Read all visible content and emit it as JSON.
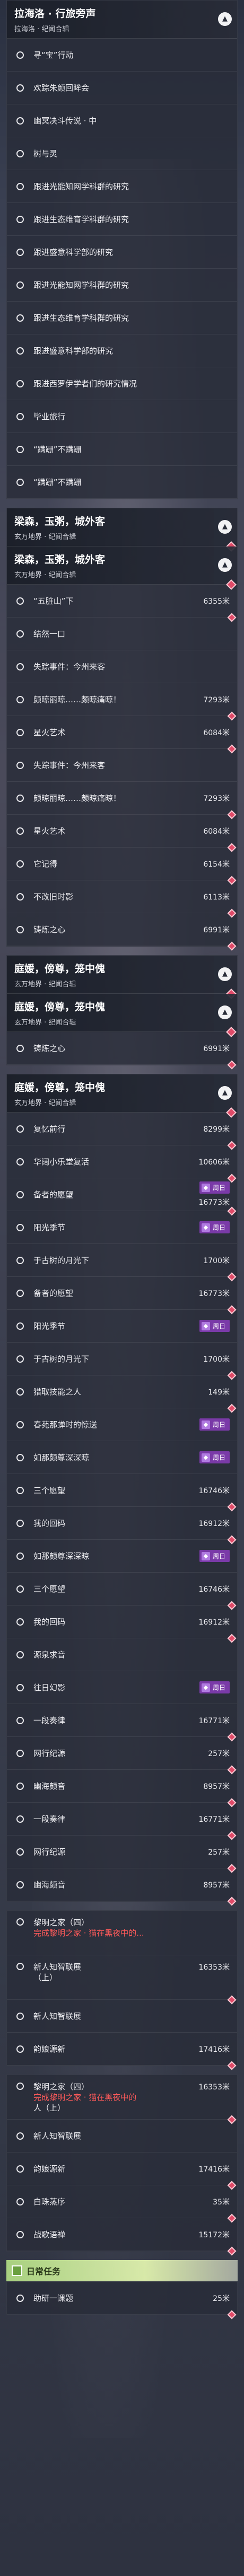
{
  "panels": [
    {
      "title": "拉海洛 · 行旅旁声",
      "subtitle": "拉海洛 · 纪闻合辑",
      "tasks": [
        {
          "name": "寻“宝”行动",
          "dist": ""
        },
        {
          "name": "欢踪朱颜回眸会",
          "dist": ""
        },
        {
          "name": "幽冥决斗传说 · 中",
          "dist": ""
        },
        {
          "name": "树与灵",
          "dist": ""
        },
        {
          "name": "跟进光能知网学科群的研究",
          "dist": ""
        },
        {
          "name": "跟进生态维育学科群的研究",
          "dist": ""
        },
        {
          "name": "跟进盛意科学部的研究",
          "dist": ""
        },
        {
          "name": "跟进光能知网学科群的研究",
          "dist": ""
        },
        {
          "name": "跟进生态维育学科群的研究",
          "dist": ""
        },
        {
          "name": "跟进盛意科学部的研究",
          "dist": ""
        },
        {
          "name": "跟进西罗伊学者们的研究情况",
          "dist": ""
        },
        {
          "name": "毕业旅行",
          "dist": ""
        },
        {
          "name": "“蹒跚”不蹒跚",
          "dist": ""
        },
        {
          "name": "“蹒跚”不蹒跚",
          "dist": ""
        }
      ]
    },
    {
      "title": "梁森，玉粥，城外客",
      "subtitle": "玄万地界 · 纪闻合辑",
      "tasks": [
        {
          "name": "梁森，玉粥，城外客",
          "dist": "",
          "isSubHeader": true
        },
        {
          "name": "“五脏山”下",
          "dist": "6355米"
        },
        {
          "name": "结然一口",
          "dist": ""
        },
        {
          "name": "失踪事件：今州来客",
          "dist": ""
        },
        {
          "name": "颇晾丽晾……颇晾痛晾！",
          "dist": "7293米"
        },
        {
          "name": "星火艺术",
          "dist": "6084米"
        },
        {
          "name": "失踪事件：今州来客",
          "dist": ""
        },
        {
          "name": "颇晾丽晾……颇晾痛晾！",
          "dist": "7293米"
        },
        {
          "name": "星火艺术",
          "dist": "6084米"
        },
        {
          "name": "它记得",
          "dist": "6154米"
        },
        {
          "name": "不改旧时影",
          "dist": "6113米"
        },
        {
          "name": "铸炼之心",
          "dist": "6991米"
        }
      ]
    },
    {
      "title": "庭媛，傍尊，笼中傀",
      "subtitle": "玄万地界 · 纪闻合辑",
      "tasks": [
        {
          "name": "庭媛，傍尊，笼中傀",
          "dist": "",
          "isSubHeader": true
        },
        {
          "name": "铸炼之心",
          "dist": "6991米"
        }
      ]
    },
    {
      "title": "庭媛，傍尊，笼中傀",
      "subtitle": "玄万地界 · 纪闻合辑",
      "tasks": [
        {
          "name": "复忆前行",
          "dist": "8299米"
        },
        {
          "name": "华阔小乐堂复活",
          "dist": "10606米"
        },
        {
          "name": "备者的愿望",
          "dist": "16773米",
          "badge": "周日"
        },
        {
          "name": "阳光季节",
          "dist": "",
          "badge": "周日"
        },
        {
          "name": "于古树的月光下",
          "dist": "1700米"
        },
        {
          "name": "备者的愿望",
          "dist": "16773米"
        },
        {
          "name": "阳光季节",
          "dist": "",
          "badge": "周日"
        },
        {
          "name": "于古树的月光下",
          "dist": "1700米"
        },
        {
          "name": "猎取技能之人",
          "dist": "149米"
        },
        {
          "name": "春苑那蝉时的惊送",
          "dist": "",
          "badge": "周日"
        },
        {
          "name": "如那颇尊深深晾",
          "dist": "",
          "badge": "周日"
        },
        {
          "name": "三个愿望",
          "dist": "16746米"
        },
        {
          "name": "我的回码",
          "dist": "16912米"
        },
        {
          "name": "如那颇尊深深晾",
          "dist": "",
          "badge": "周日"
        },
        {
          "name": "三个愿望",
          "dist": "16746米"
        },
        {
          "name": "我的回码",
          "dist": "16912米"
        },
        {
          "name": "源泉求音",
          "dist": ""
        },
        {
          "name": "往日幻影",
          "dist": "",
          "badge": "周日"
        },
        {
          "name": "一段奏律",
          "dist": "16771米"
        },
        {
          "name": "网行纪源",
          "dist": "257米"
        },
        {
          "name": "幽海颇音",
          "dist": "8957米"
        },
        {
          "name": "一段奏律",
          "dist": "16771米"
        },
        {
          "name": "网行纪源",
          "dist": "257米"
        },
        {
          "name": "幽海颇音",
          "dist": "8957米"
        }
      ]
    }
  ],
  "special": [
    {
      "line1": "黎明之家（四）",
      "line2": "完成黎明之家 · 猫在黑夜中的...",
      "line3": "",
      "dist": ""
    },
    {
      "line1": "新人知智联展",
      "line2": "（上）",
      "line3": "",
      "dist": "16353米"
    }
  ],
  "tail_tasks": [
    {
      "name": "新人知智联展",
      "dist": ""
    },
    {
      "name": "韵娘源新",
      "dist": "17416米"
    }
  ],
  "special2": [
    {
      "line1": "黎明之家（四）",
      "line2": "完成黎明之家 · 猫在黑夜中的",
      "line3": "人（上）",
      "dist": "16353米"
    }
  ],
  "tail_tasks2": [
    {
      "name": "新人知智联展",
      "dist": ""
    },
    {
      "name": "韵娘源新",
      "dist": "17416米"
    },
    {
      "name": "白珠蒸序",
      "dist": "35米"
    },
    {
      "name": "战歌语禅",
      "dist": "15172米"
    }
  ],
  "daily": {
    "title": "日常任务",
    "tasks": [
      {
        "name": "助研一课题",
        "dist": "25米"
      }
    ]
  },
  "badge_label": "周日",
  "colors": {
    "accent_red": "#e04a68",
    "badge_purple": "#7a3aa8",
    "daily_green": "#a8d080"
  }
}
